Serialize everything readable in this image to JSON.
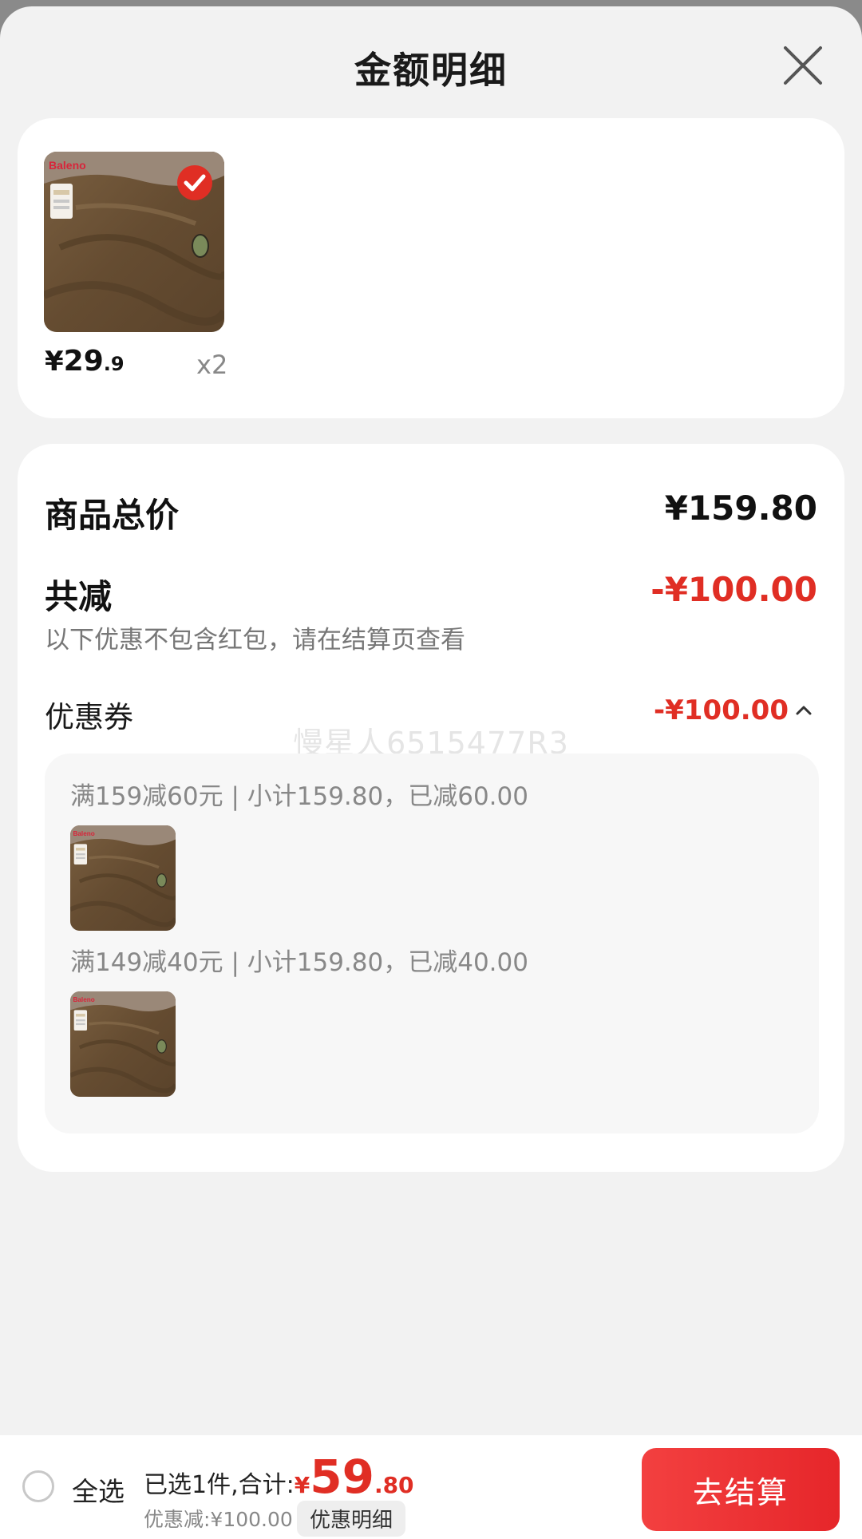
{
  "header": {
    "title": "金额明细",
    "close_icon": "close-icon"
  },
  "product": {
    "price_currency": "¥",
    "price_integer": "29",
    "price_decimal": ".9",
    "quantity": "x2",
    "checked": true,
    "brand_logo_text": "Baleno"
  },
  "summary": {
    "goods_total_label": "商品总价",
    "goods_total_value": "¥159.80",
    "reduction_label": "共减",
    "reduction_value": "-¥100.00",
    "reduction_note": "以下优惠不包含红包，请在结算页查看",
    "coupon_label": "优惠券",
    "coupon_value": "-¥100.00",
    "watermark": "慢星人6515477R3",
    "coupons": [
      {
        "text": "满159减60元 | 小计159.80，已减60.00"
      },
      {
        "text": "满149减40元 | 小计159.80，已减40.00"
      }
    ]
  },
  "bottom_bar": {
    "select_all_label": "全选",
    "selected_prefix": "已选1件,合计:",
    "total_currency": "¥",
    "total_integer": "59",
    "total_decimal": ".80",
    "discount_text": "优惠减:¥100.00",
    "detail_button": "优惠明细",
    "checkout_button": "去结算"
  },
  "colors": {
    "accent_red": "#e02e24",
    "checkout_gradient_start": "#f34040",
    "checkout_gradient_end": "#e6262a",
    "sheet_background": "#f2f2f2",
    "product_brown": "#6a5135"
  }
}
